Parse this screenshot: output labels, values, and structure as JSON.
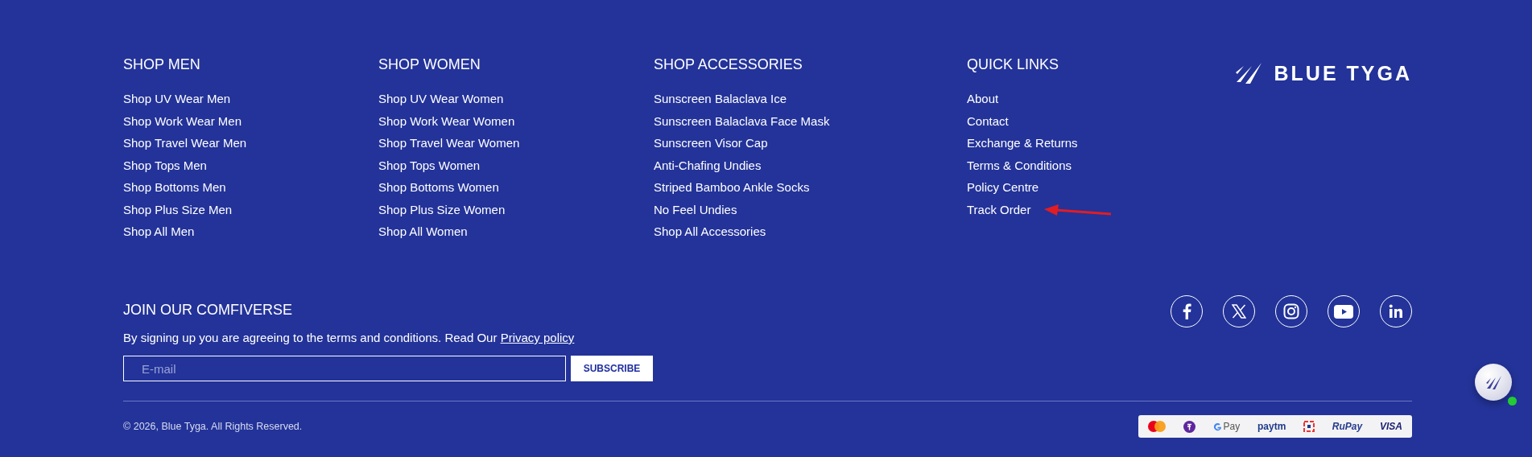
{
  "columns": [
    {
      "heading": "SHOP MEN",
      "links": [
        "Shop UV Wear Men",
        "Shop Work Wear Men",
        "Shop Travel Wear Men",
        "Shop Tops Men",
        "Shop Bottoms Men",
        "Shop Plus Size Men",
        "Shop All Men"
      ]
    },
    {
      "heading": "SHOP WOMEN",
      "links": [
        "Shop UV Wear Women",
        "Shop Work Wear Women",
        "Shop Travel Wear Women",
        "Shop Tops Women",
        "Shop Bottoms Women",
        "Shop Plus Size Women",
        "Shop All Women"
      ]
    },
    {
      "heading": "SHOP ACCESSORIES",
      "links": [
        "Sunscreen Balaclava Ice",
        "Sunscreen Balaclava Face Mask",
        "Sunscreen Visor Cap",
        "Anti-Chafing Undies",
        "Striped Bamboo Ankle Socks",
        "No Feel Undies",
        "Shop All Accessories"
      ]
    },
    {
      "heading": "QUICK LINKS",
      "links": [
        "About",
        "Contact",
        "Exchange & Returns",
        "Terms & Conditions",
        "Policy Centre",
        "Track Order"
      ]
    }
  ],
  "brand": "BLUE TYGA",
  "newsletter": {
    "heading": "JOIN OUR COMFIVERSE",
    "text": "By signing up you are agreeing to the terms and conditions. Read Our",
    "link": "Privacy policy",
    "placeholder": "E-mail",
    "button": "SUBSCRIBE"
  },
  "social": [
    {
      "kind": "facebook"
    },
    {
      "kind": "x"
    },
    {
      "kind": "instagram"
    },
    {
      "kind": "youtube"
    },
    {
      "kind": "linkedin"
    }
  ],
  "copyright": "© 2026, Blue Tyga. All Rights Reserved.",
  "payments": [
    {
      "kind": "mastercard"
    },
    {
      "kind": "phonepe"
    },
    {
      "kind": "gpay",
      "label": "Pay"
    },
    {
      "kind": "paytm",
      "label": "paytm"
    },
    {
      "kind": "hdfc"
    },
    {
      "kind": "rupay",
      "label": "RuPay"
    },
    {
      "kind": "visa",
      "label": "VISA"
    }
  ],
  "chat": {
    "online": true
  }
}
